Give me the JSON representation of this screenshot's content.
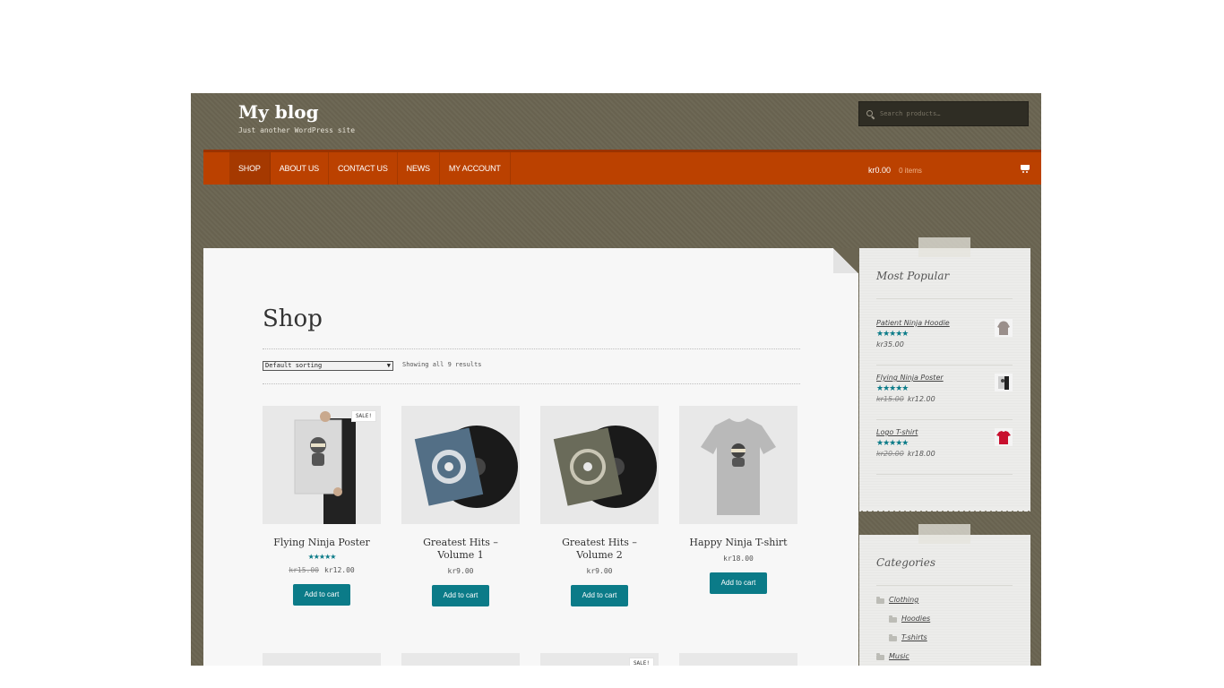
{
  "site": {
    "title": "My blog",
    "description": "Just another WordPress site"
  },
  "search": {
    "placeholder": "Search products…"
  },
  "nav": {
    "items": [
      {
        "label": "Shop",
        "active": true
      },
      {
        "label": "About Us"
      },
      {
        "label": "Contact Us"
      },
      {
        "label": "News"
      },
      {
        "label": "My Account"
      }
    ]
  },
  "cart": {
    "amount": "kr0.00",
    "count": "0 items"
  },
  "shop": {
    "title": "Shop",
    "sort_selected": "Default sorting",
    "result_count": "Showing all 9 results",
    "products": [
      {
        "title": "Flying Ninja Poster",
        "sale": "SALE!",
        "rating_stars": "★★★★★",
        "rating": 4.5,
        "price_old": "kr15.00",
        "price": "kr12.00",
        "button": "Add to cart"
      },
      {
        "title": "Greatest Hits – Volume 1",
        "price": "kr9.00",
        "button": "Add to cart"
      },
      {
        "title": "Greatest Hits – Volume 2",
        "price": "kr9.00",
        "button": "Add to cart"
      },
      {
        "title": "Happy Ninja T-shirt",
        "price": "kr18.00",
        "button": "Add to cart"
      }
    ],
    "row2_sale": "SALE!"
  },
  "widgets": {
    "popular": {
      "title": "Most Popular",
      "items": [
        {
          "name": "Patient Ninja Hoodie",
          "stars": "★★★★★",
          "rating": 5,
          "price": "kr35.00"
        },
        {
          "name": "Flying Ninja Poster",
          "stars": "★★★★★",
          "rating": 4.5,
          "price_old": "kr15.00",
          "price": "kr12.00"
        },
        {
          "name": "Logo T-shirt",
          "stars": "★★★★★",
          "rating": 4,
          "price_old": "kr20.00",
          "price": "kr18.00"
        }
      ]
    },
    "categories": {
      "title": "Categories",
      "items": [
        {
          "label": "Clothing",
          "level": 0
        },
        {
          "label": "Hoodies",
          "level": 1
        },
        {
          "label": "T-shirts",
          "level": 1
        },
        {
          "label": "Music",
          "level": 0
        }
      ]
    }
  },
  "colors": {
    "background": "#6b6552",
    "nav": "#bb4100",
    "accent": "#0b7b88",
    "content": "#f7f7f7"
  }
}
